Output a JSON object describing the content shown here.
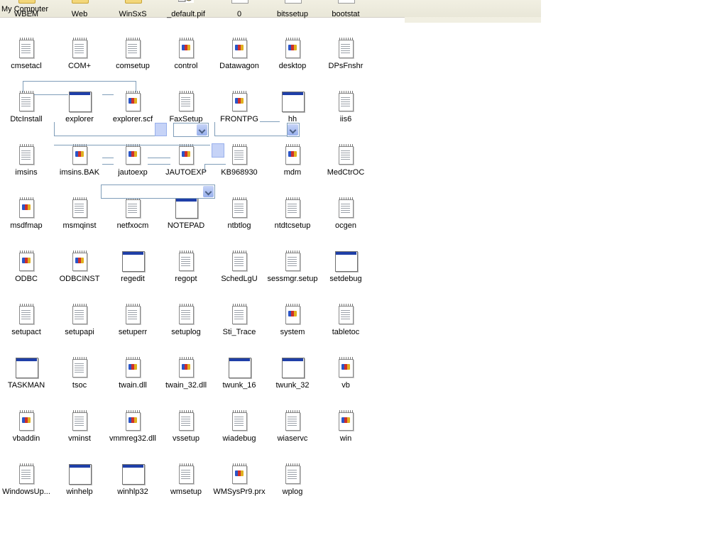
{
  "window": {
    "address_label": "My Computer"
  },
  "top_row": [
    {
      "label": "WBEM",
      "icon": "folder-icon"
    },
    {
      "label": "Web",
      "icon": "folder-icon"
    },
    {
      "label": "WinSxS",
      "icon": "folder-icon"
    },
    {
      "label": "_default.pif",
      "icon": "shortcut-icon"
    },
    {
      "label": "0",
      "icon": "file-icon"
    },
    {
      "label": "bitssetup",
      "icon": "file-icon"
    },
    {
      "label": "bootstat",
      "icon": "file-icon"
    }
  ],
  "files": [
    {
      "label": "cmsetacl",
      "icon": "text"
    },
    {
      "label": "COM+",
      "icon": "text"
    },
    {
      "label": "comsetup",
      "icon": "text"
    },
    {
      "label": "control",
      "icon": "cfg"
    },
    {
      "label": "Datawagon",
      "icon": "cfg"
    },
    {
      "label": "desktop",
      "icon": "cfg"
    },
    {
      "label": "DPsFnshr",
      "icon": "text"
    },
    {
      "label": "DtcInstall",
      "icon": "text"
    },
    {
      "label": "explorer",
      "icon": "app"
    },
    {
      "label": "explorer.scf",
      "icon": "cfg"
    },
    {
      "label": "FaxSetup",
      "icon": "text"
    },
    {
      "label": "FRONTPG",
      "icon": "cfg"
    },
    {
      "label": "hh",
      "icon": "app"
    },
    {
      "label": "iis6",
      "icon": "text"
    },
    {
      "label": "imsins",
      "icon": "text"
    },
    {
      "label": "imsins.BAK",
      "icon": "cfg"
    },
    {
      "label": "jautoexp",
      "icon": "cfg"
    },
    {
      "label": "JAUTOEXP",
      "icon": "cfg"
    },
    {
      "label": "KB968930",
      "icon": "text"
    },
    {
      "label": "mdm",
      "icon": "cfg"
    },
    {
      "label": "MedCtrOC",
      "icon": "text"
    },
    {
      "label": "msdfmap",
      "icon": "cfg"
    },
    {
      "label": "msmqinst",
      "icon": "text"
    },
    {
      "label": "netfxocm",
      "icon": "text"
    },
    {
      "label": "NOTEPAD",
      "icon": "app"
    },
    {
      "label": "ntbtlog",
      "icon": "text"
    },
    {
      "label": "ntdtcsetup",
      "icon": "text"
    },
    {
      "label": "ocgen",
      "icon": "text"
    },
    {
      "label": "ODBC",
      "icon": "cfg"
    },
    {
      "label": "ODBCINST",
      "icon": "cfg"
    },
    {
      "label": "regedit",
      "icon": "app"
    },
    {
      "label": "regopt",
      "icon": "text"
    },
    {
      "label": "SchedLgU",
      "icon": "text"
    },
    {
      "label": "sessmgr.setup",
      "icon": "text"
    },
    {
      "label": "setdebug",
      "icon": "app"
    },
    {
      "label": "setupact",
      "icon": "text"
    },
    {
      "label": "setupapi",
      "icon": "text"
    },
    {
      "label": "setuperr",
      "icon": "text"
    },
    {
      "label": "setuplog",
      "icon": "text"
    },
    {
      "label": "Sti_Trace",
      "icon": "text"
    },
    {
      "label": "system",
      "icon": "cfg"
    },
    {
      "label": "tabletoc",
      "icon": "text"
    },
    {
      "label": "TASKMAN",
      "icon": "app"
    },
    {
      "label": "tsoc",
      "icon": "text"
    },
    {
      "label": "twain.dll",
      "icon": "cfg"
    },
    {
      "label": "twain_32.dll",
      "icon": "cfg"
    },
    {
      "label": "twunk_16",
      "icon": "app"
    },
    {
      "label": "twunk_32",
      "icon": "app"
    },
    {
      "label": "vb",
      "icon": "cfg"
    },
    {
      "label": "vbaddin",
      "icon": "cfg"
    },
    {
      "label": "vminst",
      "icon": "text"
    },
    {
      "label": "vmmreg32.dll",
      "icon": "cfg"
    },
    {
      "label": "vssetup",
      "icon": "text"
    },
    {
      "label": "wiadebug",
      "icon": "text"
    },
    {
      "label": "wiaservc",
      "icon": "text"
    },
    {
      "label": "win",
      "icon": "cfg"
    },
    {
      "label": "WindowsUp...",
      "icon": "text"
    },
    {
      "label": "winhelp",
      "icon": "app"
    },
    {
      "label": "winhlp32",
      "icon": "app"
    },
    {
      "label": "wmsetup",
      "icon": "text"
    },
    {
      "label": "WMSysPr9.prx",
      "icon": "cfg"
    },
    {
      "label": "wplog",
      "icon": "text"
    }
  ],
  "colors": {
    "title_bar_blue": "#1f3fa8",
    "dialog_border": "#7f9db9",
    "folder_yellow": "#f3d77a"
  }
}
